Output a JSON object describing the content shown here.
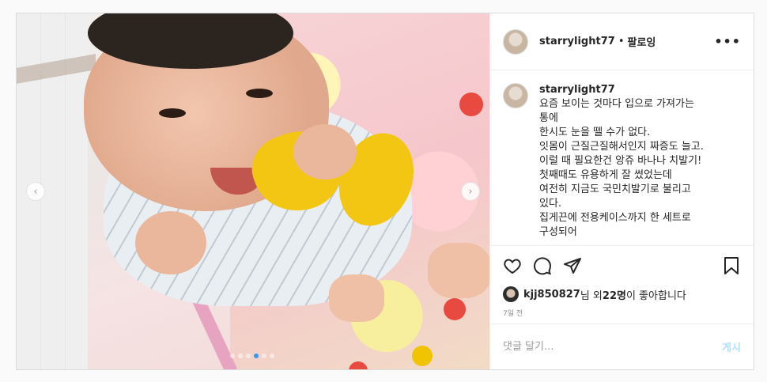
{
  "post": {
    "username": "starrylight77",
    "separator": "•",
    "follow_label": "팔로잉",
    "more_label": "•••",
    "caption": {
      "username": "starrylight77",
      "lines": [
        "요즘 보이는 것마다 입으로 가져가는",
        "통에",
        "한시도 눈을 뗄 수가 없다.",
        "잇몸이 근질근질해서인지 짜증도 늘고.",
        "이럴 때 필요한건 앙쥬 바나나 치발기!",
        "첫째때도 유용하게 잘 썼었는데",
        "여전히 지금도 국민치발기로 불리고",
        "있다.",
        "집게끈에 전용케이스까지 한 세트로",
        "구성되어"
      ]
    },
    "likes": {
      "user": "kjj850827",
      "mid": "님 외 ",
      "count": "22명",
      "suffix": "이 좋아합니다"
    },
    "time": "7일 전",
    "comment": {
      "placeholder": "댓글 달기...",
      "post_label": "게시"
    },
    "nav": {
      "prev": "‹",
      "next": "›"
    },
    "carousel_dots": 6,
    "active_dot": 3
  },
  "colors": {
    "accent": "#3897f0",
    "post_button": "#b2dffc",
    "border": "#dbdbdb"
  },
  "icons": [
    "heart-icon",
    "comment-icon",
    "share-icon",
    "bookmark-icon",
    "more-icon",
    "chevron-left-icon",
    "chevron-right-icon"
  ]
}
